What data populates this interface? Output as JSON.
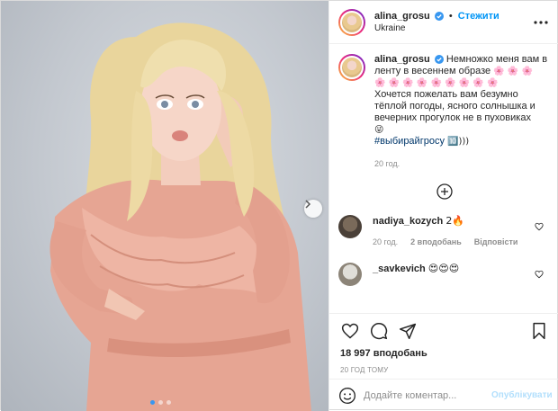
{
  "header": {
    "username": "alina_grosu",
    "separator": "•",
    "follow_label": "Стежити",
    "location": "Ukraine"
  },
  "caption": {
    "username": "alina_grosu",
    "line1": "Немножко меня вам в ленту в весеннем образе",
    "emoji_row1": "🌸 🌸 🌸",
    "emoji_row2": "🌸 🌸 🌸 🌸 🌸 🌸 🌸 🌸 🌸",
    "line2": "Хочется пожелать вам безумно тёплой погоды, ясного солнышка и вечерних прогулок не в пуховиках",
    "emoji_smile": "😜",
    "hashtag": "#выбирайгросу",
    "hashtag_suffix": "🔟)))",
    "time": "20 год."
  },
  "comments": [
    {
      "username": "nadiya_kozych",
      "text": "2🔥",
      "time": "20 год.",
      "likes": "2 вподобань",
      "reply": "Відповісти"
    },
    {
      "username": "_savkevich",
      "text": "😍😍😍",
      "time": "",
      "likes": "",
      "reply": ""
    }
  ],
  "post": {
    "likes": "18 997 вподобань",
    "timestamp": "20 ГОД ТОМУ",
    "comment_placeholder": "Додайте коментар...",
    "publish_label": "Опублікувати"
  },
  "colors": {
    "accent": "#0095f6",
    "publish_disabled": "#b2dffc",
    "hashtag": "#00376b",
    "dress": "#e8a796"
  },
  "icons": {
    "verified": "verified-badge-icon",
    "more": "more-options-icon",
    "load_more": "plus-circle-icon",
    "like": "heart-icon",
    "comment": "comment-bubble-icon",
    "share": "paper-plane-icon",
    "save": "bookmark-icon",
    "emoji": "smiley-icon",
    "next": "chevron-right-icon"
  },
  "carousel": {
    "slides": 3,
    "active_slide": 1
  }
}
